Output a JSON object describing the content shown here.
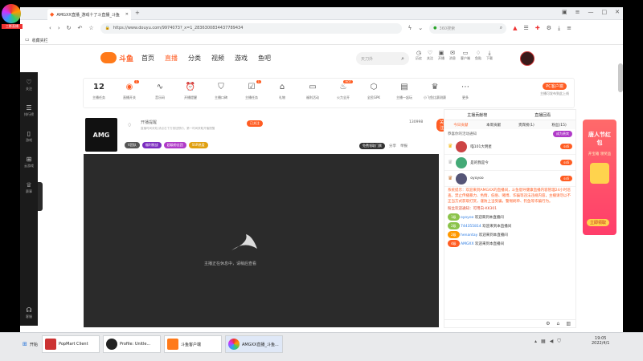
{
  "browser": {
    "logo_label": "三影直播",
    "tab_title": "AMGXX直播_游戏十了斗直播_斗鱼",
    "url": "https://www.douyu.com/9974073?_x=1_2836300834437789434",
    "search_placeholder": "360搜索",
    "fav_label": "收藏夹栏"
  },
  "header": {
    "site_logo": "斗鱼",
    "nav": [
      "首页",
      "直播",
      "分类",
      "视频",
      "游戏",
      "鱼吧"
    ],
    "search_placeholder": "天刀外",
    "user_icons": [
      "历史",
      "关注",
      "开播",
      "消息",
      "客户端",
      "鱼贴",
      "下载"
    ]
  },
  "left_rail": [
    "关注",
    "排行榜",
    "游戏",
    "云游戏",
    "赛事",
    "客服"
  ],
  "toolbar": {
    "level": "12",
    "level_label": "主播任务",
    "items": [
      "直播开关",
      "音乐码",
      "开播提醒",
      "主播口碑",
      "主播任务",
      "礼物",
      "福利活动",
      "火力全开",
      "全民GPK",
      "主播一起玩",
      "小飞鱼比赛测赛",
      "更多"
    ],
    "pc_button": "PC客户端",
    "pc_sub": "主播可发布到此上线"
  },
  "anchor": {
    "name": "开播提醒",
    "desc": "直播时间未知,请点击下方按钮预约，第一时间获取开播提醒",
    "follow": "已关注",
    "follow_count": "130998",
    "follow_btn": "关注",
    "tags": [
      "V团队",
      "福利挑战",
      "超级粉丝团",
      "SSR热爱"
    ],
    "extra_buttons": [
      "免费领取门票",
      "分享",
      "举报"
    ]
  },
  "player": {
    "status": "主播正在休息中，请稍后查看"
  },
  "chat": {
    "tabs": [
      "主播贡献榜",
      "直播回看"
    ],
    "subtabs": [
      "今日贡献",
      "本周贡献",
      "贵宾榜(1)",
      "粉丝(15)"
    ],
    "banner": "恭喜你的活动通知",
    "rank": [
      {
        "name": "喵101大明星",
        "tag": "ss6"
      },
      {
        "name": "是的我是今",
        "tag": "ss6"
      },
      {
        "name": "oyoyoo",
        "tag": "ss6"
      }
    ],
    "system_notice": "系统提示：欢迎来到AMGXX的直播间，斗鱼倡导健康直播内容管理24小时巡查。禁止传播暴力、色情、低俗、赌博、诈骗等违法违规内容，主播请勿以不正当方式获取打赏，谨防上当受骗，警惕刷单、钓鱼等诈骗行为。",
    "welcome": "粉丝欢迎通知：可用白-KK301",
    "messages": [
      {
        "level": "1级",
        "user": "oyoyoo",
        "text": "欢迎来到本直播间"
      },
      {
        "level": "2级",
        "user": "744355814",
        "text": "欢迎来到本直播间"
      },
      {
        "level": "2级",
        "user": "henantay",
        "text": "欢迎来到本直播间"
      },
      {
        "level": "4级",
        "user": "AMGXX",
        "text": "欢迎来到本直播间"
      }
    ]
  },
  "side_ad": {
    "title": "唐人节红包",
    "sub": "开宝箱 领奖品",
    "btn": "立即领取"
  },
  "taskbar": {
    "start": "开始",
    "items": [
      "PopMart Client",
      "Profile: Unitle...",
      "斗鱼客户端",
      "AMGXX直播_斗鱼..."
    ],
    "time": "19:05",
    "date": "2022/4/1"
  },
  "colors": {
    "accent": "#ff5d23",
    "chat_bg": "#ffffff",
    "player_bg": "#2b2b2b",
    "rail_bg": "#1b1b1b"
  }
}
